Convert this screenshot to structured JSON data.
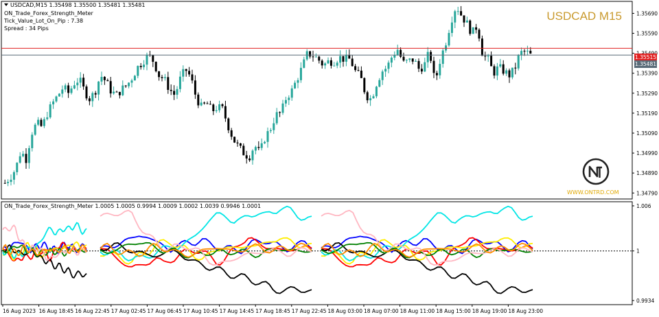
{
  "header": {
    "symbol_line": "USDCAD,M15  1.35498 1.35500 1.35481 1.35481",
    "indicator_name": "ON_Trade_Forex_Strength_Meter",
    "tick_value": "Tick_Value_Lot_On_Pip : 7.38",
    "spread": "Spread : 34  Pips"
  },
  "symbol_title": "USDCAD M15",
  "logo": {
    "url": "WWW.ONTRD.COM",
    "icon": "ontrd-logo-icon"
  },
  "price_axis": {
    "labels": [
      "1.35690",
      "1.35590",
      "1.35490",
      "1.35390",
      "1.35290",
      "1.35190",
      "1.35090",
      "1.34990",
      "1.34890",
      "1.34790"
    ],
    "ask_tag": "1.35515",
    "bid_tag": "1.35481"
  },
  "indicator": {
    "header": "ON_Trade_Forex_Strength_Meter 1.0005 1.0005 0.9994 1.0009 1.0002 1.0039 0.9946 1.0001",
    "axis_labels": [
      "1.006",
      "1",
      "0.9934"
    ]
  },
  "time_axis": [
    "16 Aug 2023",
    "16 Aug 18:45",
    "16 Aug 22:45",
    "17 Aug 02:45",
    "17 Aug 06:45",
    "17 Aug 10:45",
    "17 Aug 14:45",
    "17 Aug 18:45",
    "17 Aug 22:45",
    "18 Aug 03:00",
    "18 Aug 07:00",
    "18 Aug 11:00",
    "18 Aug 15:00",
    "18 Aug 19:00",
    "18 Aug 23:00"
  ],
  "colors": {
    "bull_candle": "#26a69a",
    "bear_candle": "#000000",
    "ask_line": "#e02020",
    "bid_line": "#5a6b78",
    "title": "#c99a2e"
  },
  "chart_data": [
    {
      "type": "candlestick",
      "title": "USDCAD M15",
      "ylim": [
        1.3476,
        1.3575
      ],
      "close_path": [
        1.3484,
        1.3487,
        1.3491,
        1.35,
        1.3496,
        1.3509,
        1.3514,
        1.3512,
        1.3519,
        1.3524,
        1.3528,
        1.3532,
        1.3529,
        1.3534,
        1.3536,
        1.353,
        1.3526,
        1.353,
        1.3538,
        1.3535,
        1.353,
        1.3528,
        1.3531,
        1.3533,
        1.3537,
        1.3542,
        1.3545,
        1.3548,
        1.3545,
        1.3538,
        1.3536,
        1.3531,
        1.3528,
        1.3536,
        1.3541,
        1.3537,
        1.3527,
        1.3522,
        1.3524,
        1.352,
        1.3522,
        1.3521,
        1.3513,
        1.3506,
        1.3502,
        1.3499,
        1.3497,
        1.3503,
        1.3499,
        1.3507,
        1.3511,
        1.3518,
        1.3519,
        1.3527,
        1.353,
        1.3536,
        1.3542,
        1.3549,
        1.3548,
        1.3546,
        1.3543,
        1.3545,
        1.3545,
        1.3547,
        1.3546,
        1.3546,
        1.354,
        1.3537,
        1.3528,
        1.3526,
        1.3534,
        1.354,
        1.3542,
        1.3548,
        1.3551,
        1.3544,
        1.3545,
        1.3546,
        1.3541,
        1.3543,
        1.355,
        1.3534,
        1.3546,
        1.3554,
        1.3565,
        1.3573,
        1.3568,
        1.3564,
        1.3559,
        1.3563,
        1.3548,
        1.3546,
        1.3539,
        1.3542,
        1.354,
        1.3538,
        1.3541,
        1.3549,
        1.355,
        1.3548
      ],
      "current_ask": 1.35515,
      "current_bid": 1.35481
    },
    {
      "type": "line",
      "title": "ON_Trade_Forex_Strength_Meter",
      "ylim": [
        0.9934,
        1.006
      ],
      "reference_line": 1.0,
      "series": [
        {
          "color": "#0000ff",
          "values": [
            1.0002,
            1.0004,
            1.0008,
            1.0013,
            1.0016,
            1.0021,
            1.0019,
            1.0012,
            1.0008,
            1.0001,
            1.0007,
            1.0012,
            1.0011,
            1.0014,
            1.0009,
            1.0006,
            1.0003,
            1.0001,
            1.0002,
            1.0007,
            1.0012,
            1.0015,
            1.001,
            1.0005,
            1.0002,
            1.0008,
            1.0012,
            1.0005
          ]
        },
        {
          "color": "#ff0000",
          "values": [
            1.0004,
            1.0001,
            0.999,
            0.9984,
            0.9978,
            0.9979,
            0.9985,
            0.999,
            0.9983,
            0.9989,
            0.9993,
            0.9998,
            1.0003,
            0.9999,
            0.9991,
            0.9985,
            0.9989,
            1.0001,
            1.0012,
            1.0018,
            1.001,
            1.0006,
            1.0004,
            1.0001,
            1.0,
            1.0003,
            1.0006,
            1.0002
          ]
        },
        {
          "color": "#ffee00",
          "values": [
            0.9996,
            0.9998,
            0.9992,
            0.9989,
            0.9986,
            0.9993,
            0.9998,
            1.0008,
            1.001,
            1.0012,
            1.0007,
            1.0001,
            0.9994,
            0.999,
            0.9995,
            1.0002,
            1.0006,
            1.0003,
            1.0004,
            1.0008,
            1.0007,
            1.0009,
            1.0014,
            1.0017,
            1.0013,
            1.001,
            1.0007,
            1.0005
          ]
        },
        {
          "color": "#00e5e5",
          "values": [
            1.0001,
            0.9999,
            0.9996,
            0.9994,
            0.9991,
            0.9989,
            0.9993,
            0.9997,
            1.0003,
            1.0006,
            1.0004,
            1.0011,
            1.0019,
            1.003,
            1.0041,
            1.005,
            1.0047,
            1.0038,
            1.0041,
            1.0048,
            1.0051,
            1.0046,
            1.0052,
            1.0058,
            1.0054,
            1.0049,
            1.0045,
            1.0041
          ]
        },
        {
          "color": "#000000",
          "values": [
            1.0003,
            1.0006,
            1.0008,
            1.0004,
            1.0,
            0.9998,
            0.9995,
            0.9993,
            0.9996,
            1.0001,
            0.9998,
            0.999,
            0.9985,
            0.9982,
            0.9978,
            0.9975,
            0.9971,
            0.9968,
            0.9965,
            0.9962,
            0.996,
            0.9955,
            0.9949,
            0.9948,
            0.9947,
            0.995,
            0.9948,
            0.9946
          ]
        },
        {
          "color": "#008000",
          "values": [
            1.0,
            0.9998,
            1.0001,
            1.0006,
            1.0009,
            1.0012,
            1.0009,
            1.0004,
            1.0001,
            1.0,
            0.9998,
            0.9996,
            0.9992,
            0.9995,
            1.0,
            0.9998,
            0.9996,
            1.0001,
            0.9999,
            0.9996,
            0.9995,
            0.9998,
            1.0001,
            1.0003,
            1.0001,
            1.0,
            0.9999,
            1.0001
          ]
        },
        {
          "color": "#ffb6c1",
          "values": [
            1.0045,
            1.0048,
            1.0051,
            1.005,
            1.0049,
            1.0035,
            1.002,
            1.0012,
            1.0006,
            1.0003,
            1.0005,
            1.0008,
            1.0002,
            0.9996,
            0.9987,
            0.9981,
            0.9984,
            0.999,
            0.9993,
            0.9996,
            0.9997,
            0.9999,
            1.0002,
            0.9998,
            0.9995,
            0.9999,
            1.0001,
            1.0003
          ]
        },
        {
          "color": "#ff8c00",
          "values": [
            1.0003,
            1.0005,
            1.0002,
            0.9998,
            0.9995,
            0.9997,
            1.0002,
            1.0006,
            1.0004,
            1.0001,
            0.9997,
            0.9994,
            0.9996,
            1.0,
            1.0003,
            1.0005,
            1.0002,
            0.9999,
            1.0001,
            1.0004,
            1.0006,
            1.0003,
            1.0,
            1.0002,
            1.0005,
            1.0007,
            1.0004,
            1.0005
          ]
        }
      ]
    }
  ]
}
